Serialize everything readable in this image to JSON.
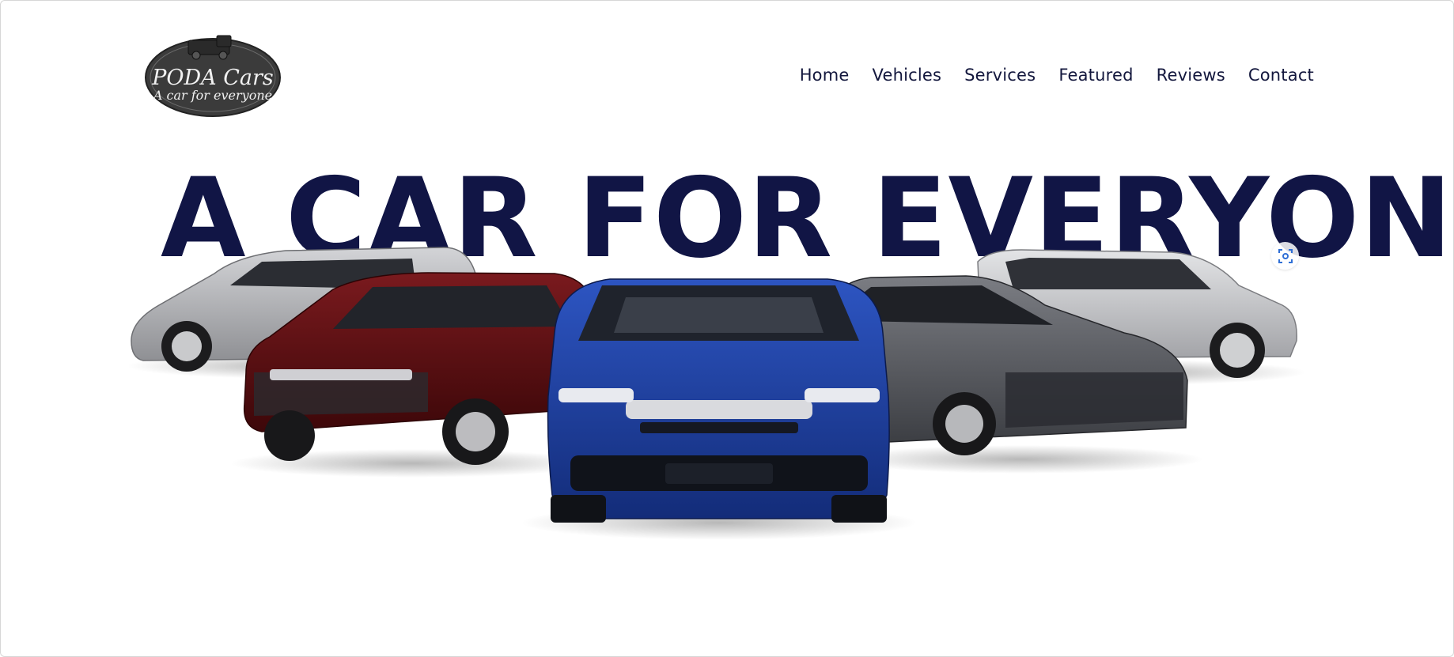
{
  "brand": {
    "name": "PODA Cars",
    "tagline": "A car for everyone"
  },
  "nav": {
    "items": [
      "Home",
      "Vehicles",
      "Services",
      "Featured",
      "Reviews",
      "Contact"
    ]
  },
  "hero": {
    "title": "A CAR FOR EVERYONE"
  },
  "cars": [
    {
      "icon": "silver-minivan-image",
      "color": "#a9aaad"
    },
    {
      "icon": "red-suv-image",
      "color": "#5b0f12"
    },
    {
      "icon": "blue-sedan-image",
      "color": "#1b3b95"
    },
    {
      "icon": "gray-sedan-image",
      "color": "#55575c"
    },
    {
      "icon": "silver-suv-image",
      "color": "#c3c4c7"
    }
  ],
  "colors": {
    "title": "#111545",
    "nav_text": "#13173d",
    "logo_bg": "#3a3a3a",
    "lens_icon": "#2f6fd6"
  }
}
